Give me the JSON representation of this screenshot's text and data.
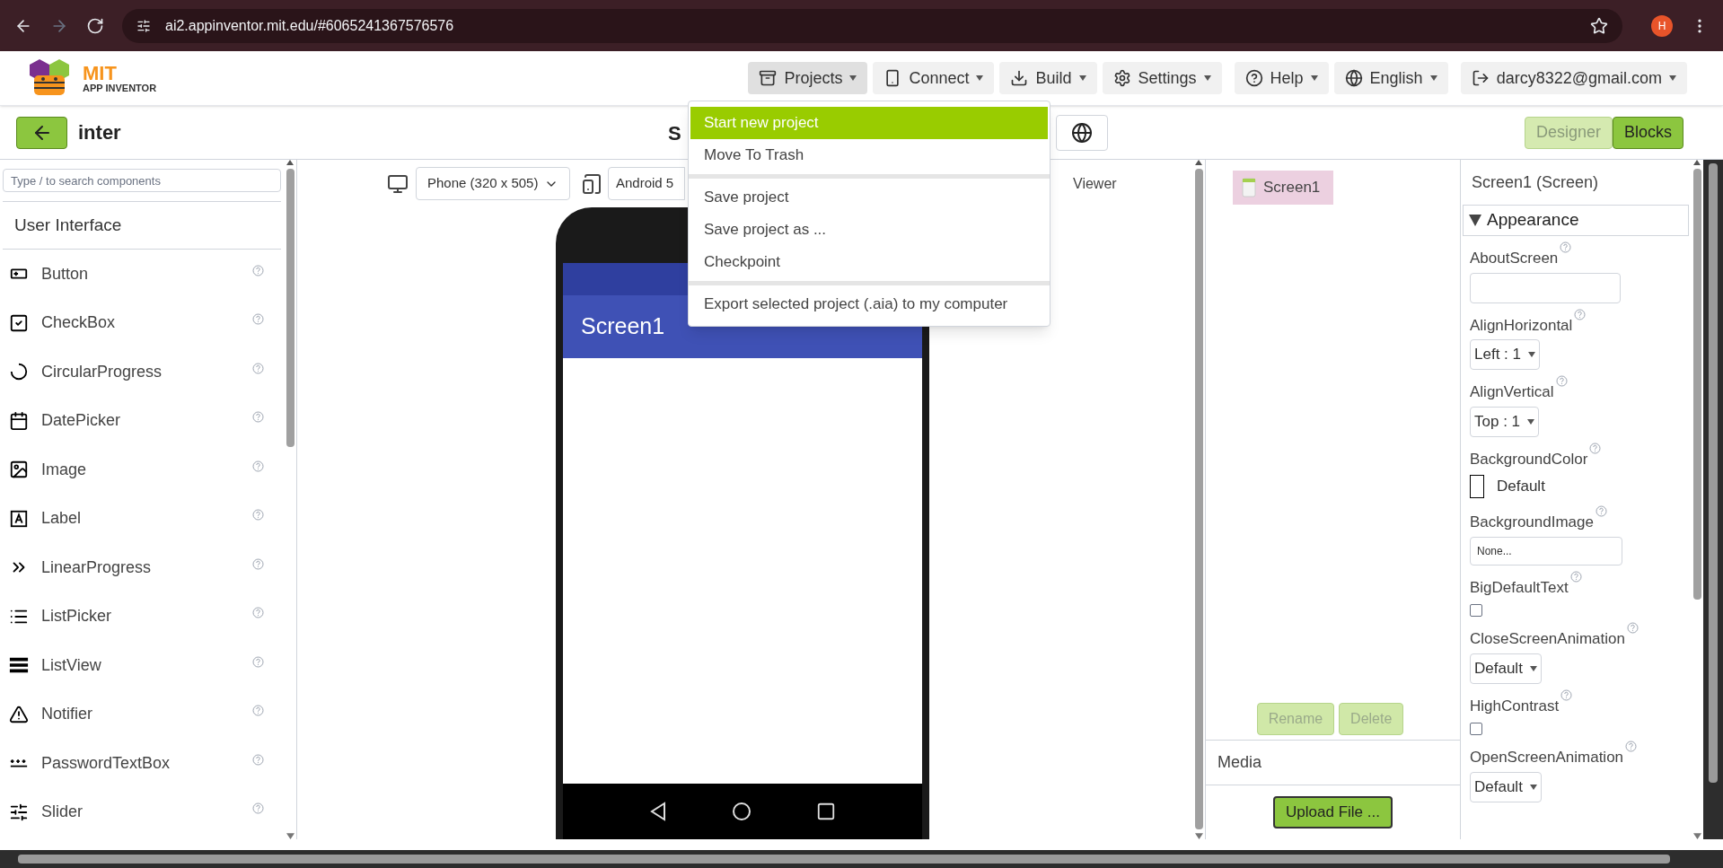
{
  "browser": {
    "url": "ai2.appinventor.mit.edu/#6065241367576576",
    "profile": "H"
  },
  "header": {
    "logo": {
      "title": "MIT",
      "subtitle": "APP INVENTOR"
    },
    "menus": [
      {
        "label": "Projects",
        "expanded": true
      },
      {
        "label": "Connect",
        "expanded": false
      },
      {
        "label": "Build",
        "expanded": false
      },
      {
        "label": "Settings",
        "expanded": false
      },
      {
        "label": "Help",
        "expanded": false
      },
      {
        "label": "English",
        "expanded": false
      },
      {
        "label": "darcy8322@gmail.com",
        "expanded": false
      }
    ]
  },
  "projects_menu": {
    "groups": [
      [
        {
          "label": "Start new project",
          "selected": true
        },
        {
          "label": "Move To Trash",
          "selected": false
        }
      ],
      [
        {
          "label": "Save project",
          "selected": false
        },
        {
          "label": "Save project as ...",
          "selected": false
        },
        {
          "label": "Checkpoint",
          "selected": false
        }
      ],
      [
        {
          "label": "Export selected project (.aia) to my computer",
          "selected": false
        }
      ]
    ]
  },
  "toolbar": {
    "project_name": "inter",
    "screen_button": "S",
    "views": [
      {
        "label": "Designer",
        "selected": true
      },
      {
        "label": "Blocks",
        "selected": false
      }
    ]
  },
  "palette": {
    "search_placeholder": "Type / to search components",
    "category": "User Interface",
    "items": [
      "Button",
      "CheckBox",
      "CircularProgress",
      "DatePicker",
      "Image",
      "Label",
      "LinearProgress",
      "ListPicker",
      "ListView",
      "Notifier",
      "PasswordTextBox",
      "Slider"
    ]
  },
  "viewer": {
    "device_select": "Phone (320 x 505)",
    "os_select": "Android 5",
    "hidden_label": "Viewer",
    "screen_title": "Screen1"
  },
  "components": {
    "tree": [
      {
        "name": "Screen1",
        "selected": true
      }
    ],
    "buttons": [
      {
        "label": "Rename",
        "disabled": true
      },
      {
        "label": "Delete",
        "disabled": true
      }
    ],
    "media_title": "Media",
    "upload_button": "Upload File ..."
  },
  "properties": {
    "title": "Screen1 (Screen)",
    "section": {
      "label": "Appearance",
      "expanded": true
    },
    "items": [
      {
        "name": "AboutScreen",
        "kind": "textarea"
      },
      {
        "name": "AlignHorizontal",
        "kind": "select",
        "value": "Left : 1"
      },
      {
        "name": "AlignVertical",
        "kind": "select",
        "value": "Top : 1"
      },
      {
        "name": "BackgroundColor",
        "kind": "color",
        "value": "Default",
        "color": "#ffffff"
      },
      {
        "name": "BackgroundImage",
        "kind": "picker",
        "value": "None..."
      },
      {
        "name": "BigDefaultText",
        "kind": "checkbox",
        "checked": false
      },
      {
        "name": "CloseScreenAnimation",
        "kind": "select",
        "value": "Default"
      },
      {
        "name": "HighContrast",
        "kind": "checkbox",
        "checked": false
      },
      {
        "name": "OpenScreenAnimation",
        "kind": "select",
        "value": "Default"
      }
    ]
  }
}
